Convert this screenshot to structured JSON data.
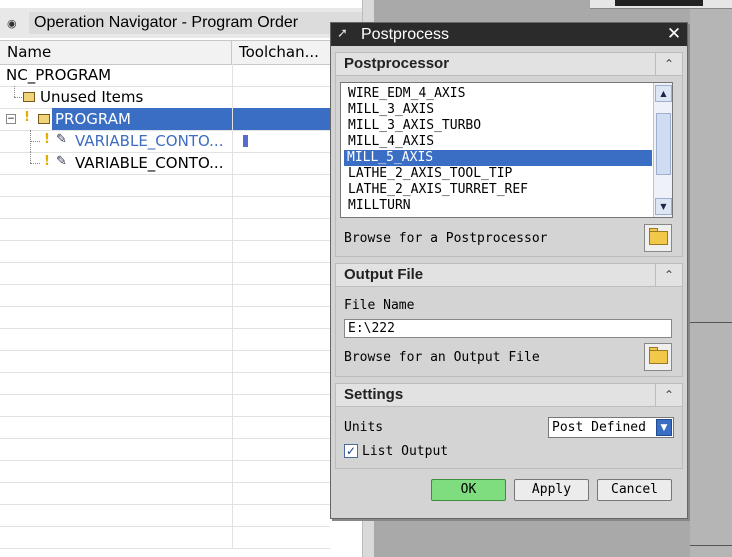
{
  "navigator": {
    "title": "Operation Navigator - Program Order",
    "columns": [
      "Name",
      "Toolchan..."
    ],
    "rows": [
      {
        "name": "NC_PROGRAM"
      },
      {
        "name": "Unused Items"
      },
      {
        "name": "PROGRAM"
      },
      {
        "name": "VARIABLE_CONTO..."
      },
      {
        "name": "VARIABLE_CONTO..."
      }
    ]
  },
  "dialog": {
    "title": "Postprocess",
    "close_symbol": "✕",
    "postprocessor": {
      "section_title": "Postprocessor",
      "items": [
        "WIRE_EDM_4_AXIS",
        "MILL_3_AXIS",
        "MILL_3_AXIS_TURBO",
        "MILL_4_AXIS",
        "MILL_5_AXIS",
        "LATHE_2_AXIS_TOOL_TIP",
        "LATHE_2_AXIS_TURRET_REF",
        "MILLTURN"
      ],
      "selected_item": "MILL_5_AXIS",
      "browse_label": "Browse for a Postprocessor"
    },
    "output_file": {
      "section_title": "Output File",
      "file_name_label": "File Name",
      "file_name_value": "E:\\222",
      "browse_label": "Browse for an Output File"
    },
    "settings": {
      "section_title": "Settings",
      "units_label": "Units",
      "units_value": "Post Defined",
      "list_output_label": "List Output",
      "list_output_checked": true
    },
    "buttons": {
      "ok": "OK",
      "apply": "Apply",
      "cancel": "Cancel"
    }
  },
  "colors": {
    "selection": "#3a6ec4",
    "ok_button": "#7fdc7f",
    "dialog_title_bar": "#2b2b2b"
  },
  "icons": [
    "pin-icon",
    "folder-icon",
    "bulb-icon",
    "operation-icon",
    "collapse-icon",
    "close-icon",
    "dropdown-arrow-icon",
    "checkmark-icon"
  ]
}
